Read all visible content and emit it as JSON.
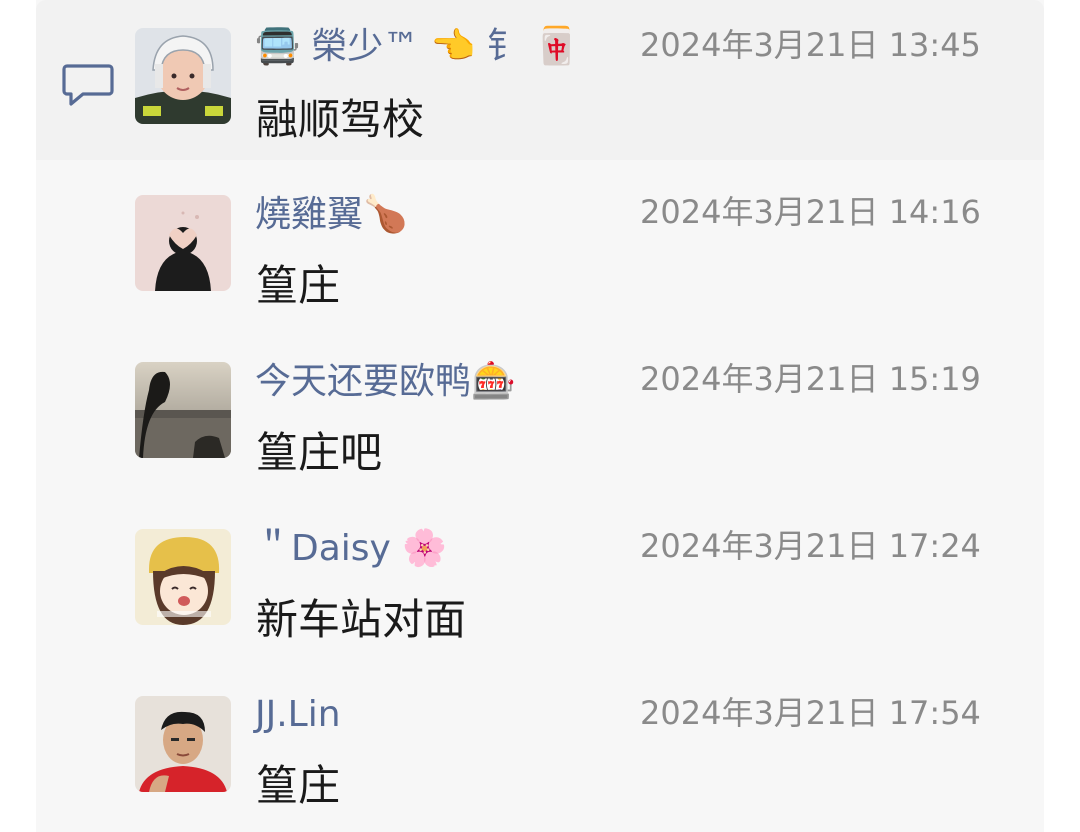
{
  "comments": [
    {
      "name": "🚍 榮少™ 👈 钅 🀄",
      "time": "2024年3月21日 13:45",
      "message": "融顺驾校",
      "avatar": "helmet-avatar"
    },
    {
      "name": "燒雞翼🍗",
      "time": "2024年3月21日 14:16",
      "message": "篁庄",
      "avatar": "heart-hands-avatar"
    },
    {
      "name": "今天还要欧鸭🎰",
      "time": "2024年3月21日 15:19",
      "message": "篁庄吧",
      "avatar": "silhouette-avatar"
    },
    {
      "name": "＂Daisy 🌸",
      "time": "2024年3月21日 17:24",
      "message": "新车站对面",
      "avatar": "cartoon-girl-avatar"
    },
    {
      "name": "JJ.Lin",
      "time": "2024年3月21日 17:54",
      "message": "篁庄",
      "avatar": "portrait-avatar"
    }
  ],
  "colors": {
    "name": "#576b95",
    "time": "#8a8a8a",
    "message": "#1a1a1a",
    "background": "#f7f7f7"
  }
}
